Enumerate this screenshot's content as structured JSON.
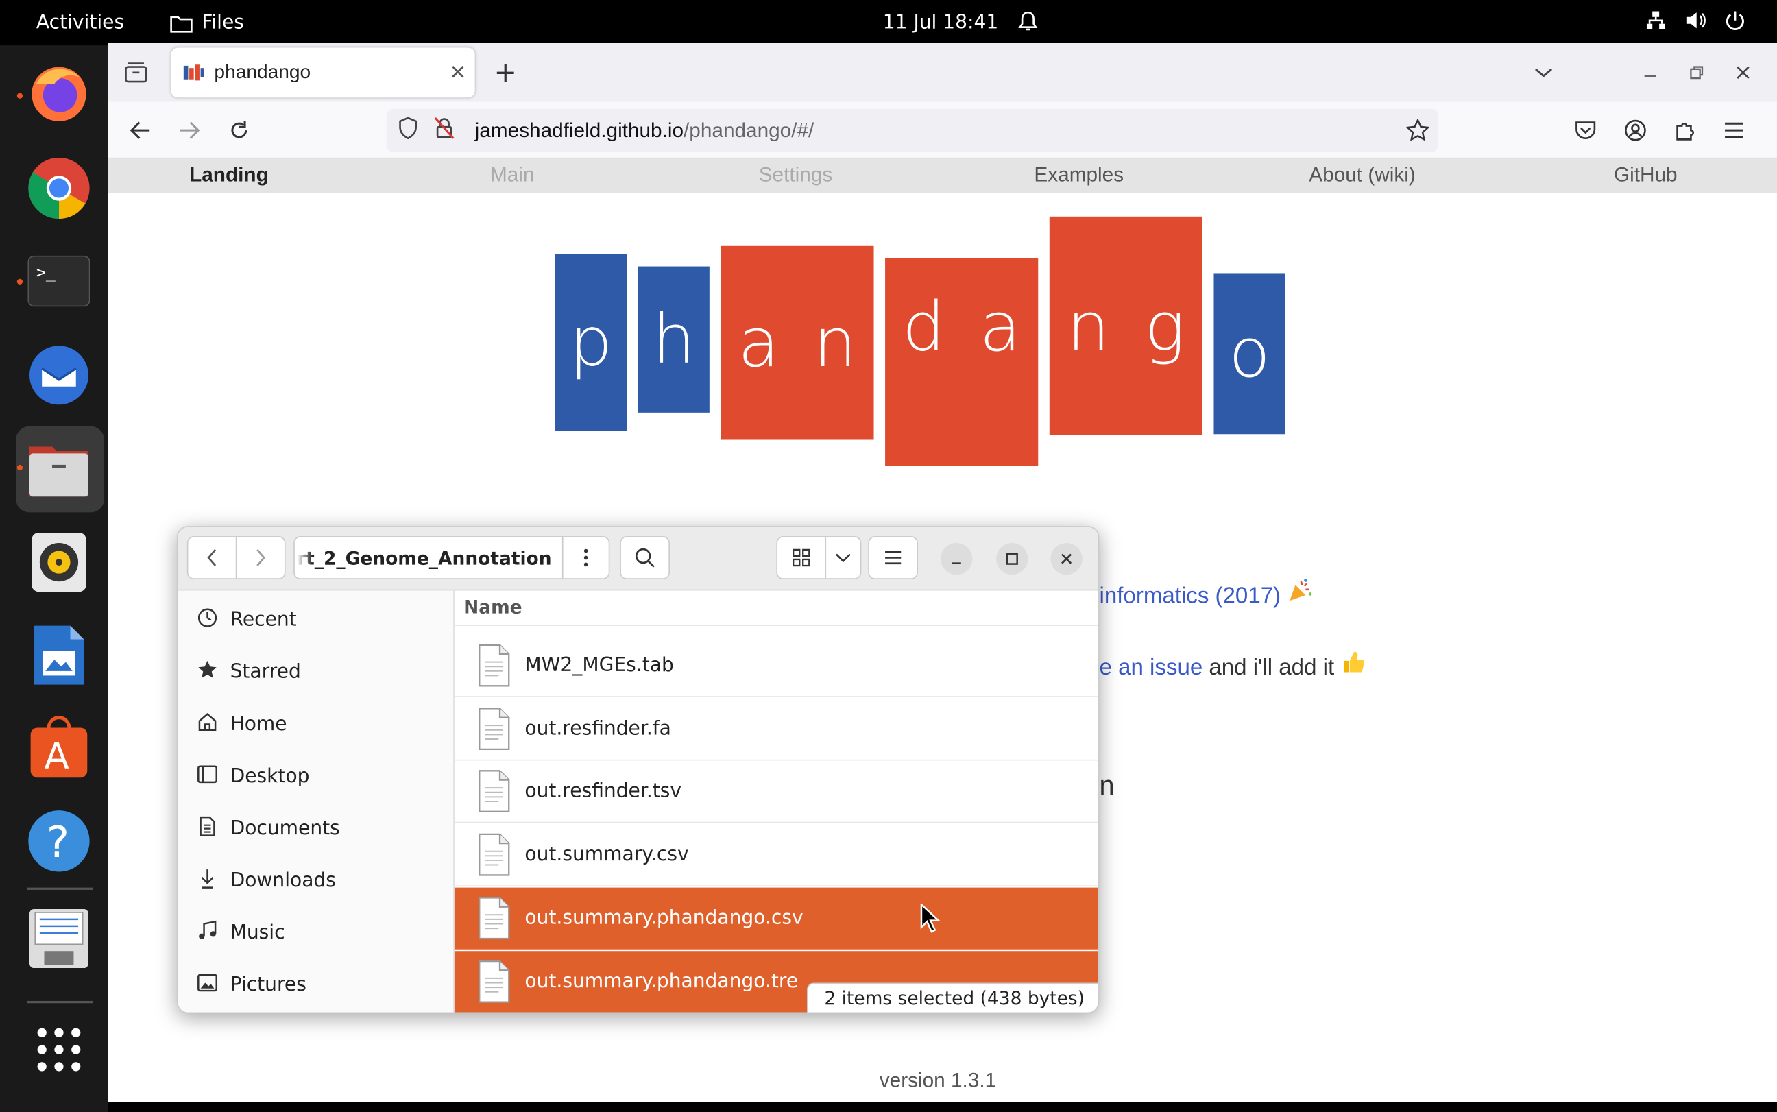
{
  "topbar": {
    "activities": "Activities",
    "app_name": "Files",
    "datetime": "11 Jul  18:41"
  },
  "dock": {
    "items": [
      "firefox-icon",
      "chrome-icon",
      "terminal-icon",
      "thunderbird-icon",
      "files-icon",
      "rhythmbox-icon",
      "writer-icon",
      "app-center-icon",
      "help-icon",
      "floppy-icon",
      "app-grid-icon"
    ]
  },
  "browser": {
    "tab_title": "phandango",
    "url_host": "jameshadfield.github.io",
    "url_path": "/phandango/#/"
  },
  "page": {
    "nav": [
      "Landing",
      "Main",
      "Settings",
      "Examples",
      "About (wiki)",
      "GitHub"
    ],
    "logo_letters": [
      "p",
      "h",
      "a",
      "n",
      "d",
      "a",
      "n",
      "g",
      "o"
    ],
    "line1_link": "informatics (2017)",
    "line2_link": "e an issue",
    "line2_text": " and i'll add it",
    "line3_text": "n",
    "version": "version 1.3.1",
    "colors": {
      "blue": "#2e5aa8",
      "red": "#e04a2f"
    }
  },
  "files": {
    "path": "rt_2_Genome_Annotation",
    "sidebar": [
      {
        "label": "Recent",
        "icon": "clock-icon"
      },
      {
        "label": "Starred",
        "icon": "star-icon"
      },
      {
        "label": "Home",
        "icon": "home-icon"
      },
      {
        "label": "Desktop",
        "icon": "desktop-icon"
      },
      {
        "label": "Documents",
        "icon": "documents-icon"
      },
      {
        "label": "Downloads",
        "icon": "downloads-icon"
      },
      {
        "label": "Music",
        "icon": "music-icon"
      },
      {
        "label": "Pictures",
        "icon": "pictures-icon"
      }
    ],
    "column_name": "Name",
    "rows": [
      {
        "name": "MW2_MGEs.tab",
        "selected": false
      },
      {
        "name": "out.resfinder.fa",
        "selected": false
      },
      {
        "name": "out.resfinder.tsv",
        "selected": false
      },
      {
        "name": "out.summary.csv",
        "selected": false
      },
      {
        "name": "out.summary.phandango.csv",
        "selected": true
      },
      {
        "name": "out.summary.phandango.tre",
        "selected": true
      }
    ],
    "status": "2 items selected  (438 bytes)",
    "accent": "#e0602b"
  }
}
